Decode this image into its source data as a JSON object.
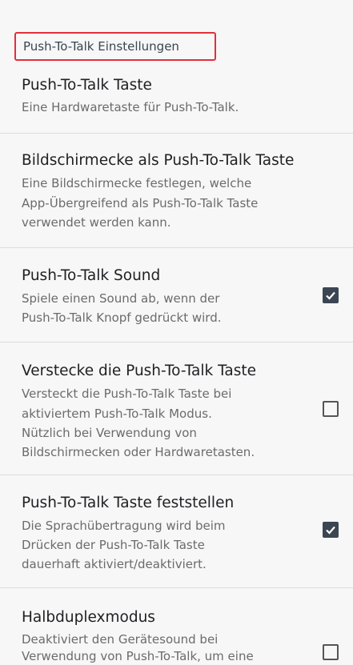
{
  "section_header": "Push-To-Talk Einstellungen",
  "items": [
    {
      "title": "Push-To-Talk Taste",
      "summary": [
        "Eine Hardwaretaste für Push-To-Talk."
      ]
    },
    {
      "title": "Bildschirmecke als Push-To-Talk Taste",
      "summary": [
        "Eine Bildschirmecke festlegen, welche",
        "App-Übergreifend als Push-To-Talk Taste",
        "verwendet werden kann."
      ]
    },
    {
      "title": "Push-To-Talk Sound",
      "summary": [
        "Spiele einen Sound ab, wenn der",
        "Push-To-Talk Knopf gedrückt wird."
      ],
      "checked": true
    },
    {
      "title": "Verstecke die Push-To-Talk Taste",
      "summary": [
        "Versteckt die Push-To-Talk Taste bei",
        "aktiviertem Push-To-Talk Modus.",
        "Nützlich bei Verwendung von",
        "Bildschirmecken oder Hardwaretasten."
      ],
      "checked": false
    },
    {
      "title": "Push-To-Talk Taste feststellen",
      "summary": [
        "Die Sprachübertragung wird beim",
        "Drücken der Push-To-Talk Taste",
        "dauerhaft aktiviert/deaktiviert."
      ],
      "checked": true
    },
    {
      "title": "Halbduplexmodus",
      "summary": [
        "Deaktiviert den Gerätesound bei",
        "Verwendung von Push-To-Talk, um eine"
      ],
      "checked": false
    }
  ]
}
